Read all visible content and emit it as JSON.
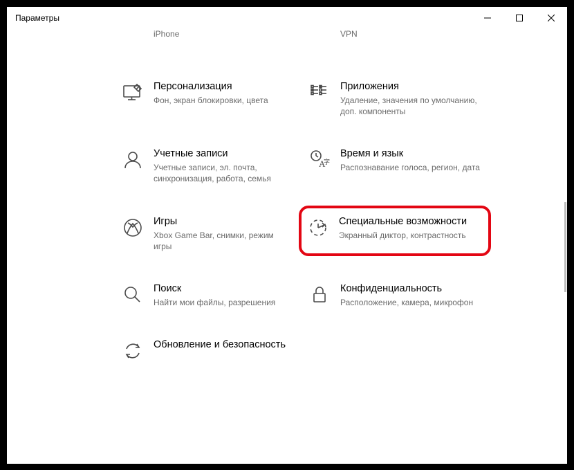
{
  "window": {
    "title": "Параметры"
  },
  "tiles": {
    "t0a": {
      "title": "",
      "desc": "iPhone"
    },
    "t0b": {
      "title": "",
      "desc": "VPN"
    },
    "t1a": {
      "title": "Персонализация",
      "desc": "Фон, экран блокировки, цвета"
    },
    "t1b": {
      "title": "Приложения",
      "desc": "Удаление, значения по умолчанию, доп. компоненты"
    },
    "t2a": {
      "title": "Учетные записи",
      "desc": "Учетные записи, эл. почта, синхронизация, работа, семья"
    },
    "t2b": {
      "title": "Время и язык",
      "desc": "Распознавание голоса, регион, дата"
    },
    "t3a": {
      "title": "Игры",
      "desc": "Xbox Game Bar, снимки, режим игры"
    },
    "t3b": {
      "title": "Специальные возможности",
      "desc": "Экранный диктор, контрастность"
    },
    "t4a": {
      "title": "Поиск",
      "desc": "Найти мои файлы, разрешения"
    },
    "t4b": {
      "title": "Конфиденциальность",
      "desc": "Расположение, камера, микрофон"
    },
    "t5a": {
      "title": "Обновление и безопасность",
      "desc": ""
    }
  }
}
